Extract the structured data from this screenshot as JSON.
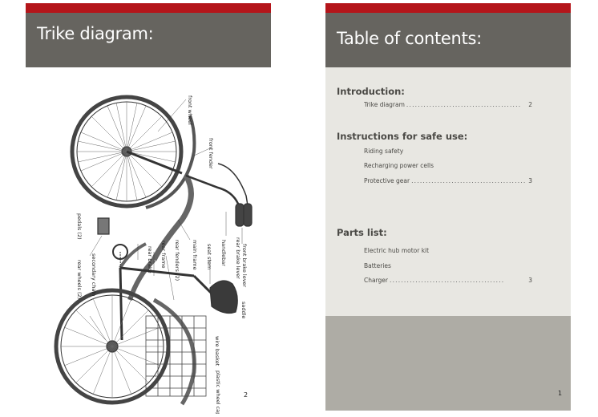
{
  "left_page": {
    "title": "Trike diagram:",
    "page_number": "2",
    "diagram_labels": {
      "front_wheel": "front wheel",
      "front_fender": "front fender",
      "front_brake_lever": "front brake lever",
      "rear_brake_lever": "rear brake lever",
      "handlebar": "handlebar",
      "seat_stem": "seat stem",
      "main_frame": "main frame",
      "rear_fenders": "rear fenders (2)",
      "rear_frame": "rear frame",
      "rear_brake": "rear brake",
      "pedals": "pedals (2)",
      "secondary_chain": "secondary chain",
      "rear_wheels": "rear wheels (2)",
      "saddle": "saddle",
      "wire_basket": "wire basket",
      "plastic_wheel_caps": "plastic wheel caps (2)"
    }
  },
  "right_page": {
    "title": "Table of contents:",
    "page_number": "1",
    "sections": [
      {
        "heading": "Introduction:",
        "entries": [
          {
            "label": "Trike diagram",
            "dots": "........................................",
            "page": "2"
          }
        ]
      },
      {
        "heading": "Instructions for safe use:",
        "entries": [
          {
            "label": "Riding safety",
            "dots": "",
            "page": ""
          },
          {
            "label": "Recharging power cells",
            "dots": "",
            "page": ""
          },
          {
            "label": "Protective gear",
            "dots": "........................................",
            "page": "3"
          }
        ]
      },
      {
        "heading": "Parts list:",
        "entries": [
          {
            "label": "Electric hub motor kit",
            "dots": "",
            "page": ""
          },
          {
            "label": "Batteries",
            "dots": "",
            "page": ""
          },
          {
            "label": "Charger",
            "dots": "........................................",
            "page": "3"
          }
        ]
      }
    ]
  },
  "colors": {
    "accent_red": "#b4151a",
    "header_gray": "#66645f",
    "page_beige": "#e8e7e2",
    "footer_gray": "#aeaca5"
  }
}
